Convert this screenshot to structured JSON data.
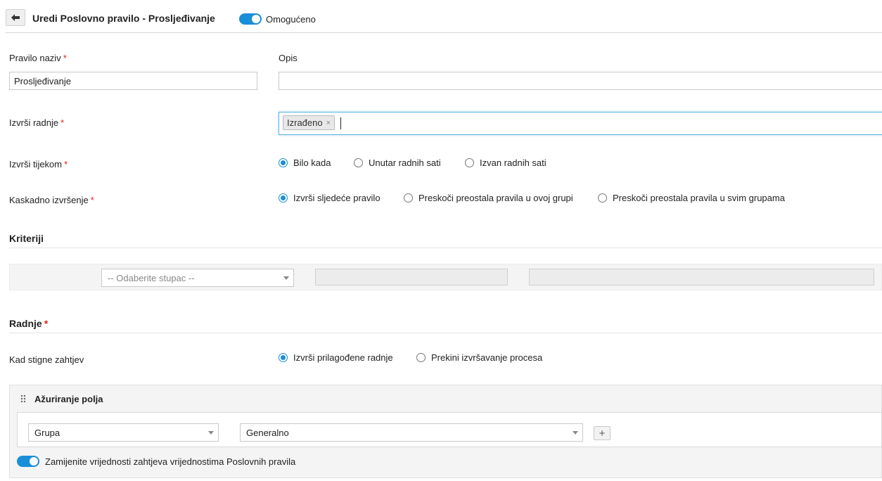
{
  "header": {
    "back_icon": "arrow-left-icon",
    "title": "Uredi Poslovno pravilo - Prosljeđivanje",
    "enabled_label": "Omogućeno",
    "enabled": true
  },
  "form": {
    "name": {
      "label": "Pravilo naziv",
      "required_mark": "*",
      "value": "Prosljeđivanje"
    },
    "description": {
      "label": "Opis",
      "value": ""
    },
    "execute_actions": {
      "label": "Izvrši radnje",
      "required_mark": "*",
      "tags": [
        "Izrađeno"
      ],
      "tag_remove": "×"
    },
    "execute_during": {
      "label": "Izvrši tijekom",
      "required_mark": "*",
      "options": [
        "Bilo kada",
        "Unutar radnih sati",
        "Izvan radnih sati"
      ],
      "selected": "Bilo kada"
    },
    "cascade": {
      "label": "Kaskadno izvršenje",
      "required_mark": "*",
      "options": [
        "Izvrši sljedeće pravilo",
        "Preskoči preostala pravila u ovoj grupi",
        "Preskoči preostala pravila u svim grupama"
      ],
      "selected": "Izvrši sljedeće pravilo"
    }
  },
  "criteria": {
    "title": "Kriteriji",
    "column_placeholder": "-- Odaberite stupac --"
  },
  "actions": {
    "title": "Radnje",
    "required_mark": "*",
    "on_request": {
      "label": "Kad stigne zahtjev",
      "options": [
        "Izvrši prilagođene radnje",
        "Prekini izvršavanje procesa"
      ],
      "selected": "Izvrši prilagođene radnje"
    },
    "panel": {
      "title": "Ažuriranje polja",
      "drag_icon": "drag-handle-icon",
      "field_select": "Grupa",
      "value_select": "Generalno",
      "add_label": "+",
      "replace_label": "Zamijenite vrijednosti zahtjeva vrijednostima Poslovnih pravila",
      "replace_enabled": true
    }
  },
  "colors": {
    "accent": "#1a8ed8",
    "required": "#e02020"
  }
}
